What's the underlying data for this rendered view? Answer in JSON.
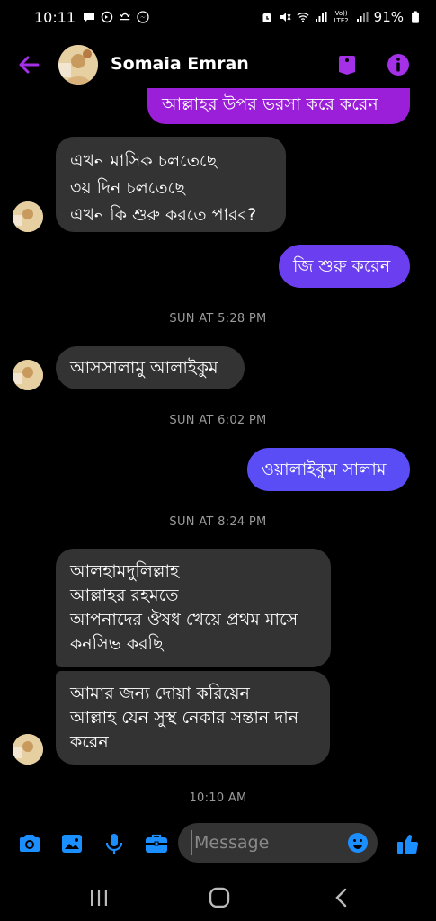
{
  "status_bar": {
    "time": "10:11",
    "battery": "91%",
    "network_badge": "Vo)) LTE2"
  },
  "header": {
    "contact_name": "Somaia Emran"
  },
  "messages": [
    {
      "dir": "out",
      "lines": [
        "আল্লাহর উপর ভরসা করে করেন"
      ]
    },
    {
      "dir": "in",
      "lines": [
        "এখন মাসিক চলতেছে",
        "৩য় দিন চলতেছে",
        "এখন কি শুরু করতে পারব?"
      ]
    },
    {
      "dir": "out",
      "lines": [
        "জি শুরু করেন"
      ]
    },
    {
      "dir": "ts",
      "text": "SUN AT 5:28 PM"
    },
    {
      "dir": "in",
      "lines": [
        "আসসালামু আলাইকুম"
      ]
    },
    {
      "dir": "ts",
      "text": "SUN AT 6:02 PM"
    },
    {
      "dir": "out",
      "lines": [
        "ওয়ালাইকুম সালাম"
      ]
    },
    {
      "dir": "ts",
      "text": "SUN AT 8:24 PM"
    },
    {
      "dir": "in",
      "lines": [
        "আলহামদুলিল্লাহ",
        "আল্লাহর রহমতে",
        "আপনাদের ঔষধ খেয়ে প্রথম মাসে",
        "কনসিভ করছি"
      ]
    },
    {
      "dir": "in",
      "lines": [
        "আমার জন্য দোয়া করিয়েন",
        "আল্লাহ যেন সুস্থ নেকার সন্তান দান",
        "করেন"
      ]
    },
    {
      "dir": "ts",
      "text": "10:10 AM"
    }
  ],
  "composer": {
    "placeholder": "Message"
  },
  "colors": {
    "accent": "#a431e8",
    "icon_blue": "#1b8fff",
    "bubble_in": "#333333",
    "bubble_out_purple": "#9b1fd9",
    "bubble_out_violet": "#6b3ff0",
    "bubble_out_blue": "#5a4df5"
  },
  "icons": {
    "back": "arrow-left-icon",
    "tag": "tag-icon",
    "info": "info-icon",
    "camera": "camera-icon",
    "gallery": "image-icon",
    "mic": "microphone-icon",
    "briefcase": "briefcase-icon",
    "emoji": "emoji-icon",
    "like": "thumbs-up-icon"
  }
}
